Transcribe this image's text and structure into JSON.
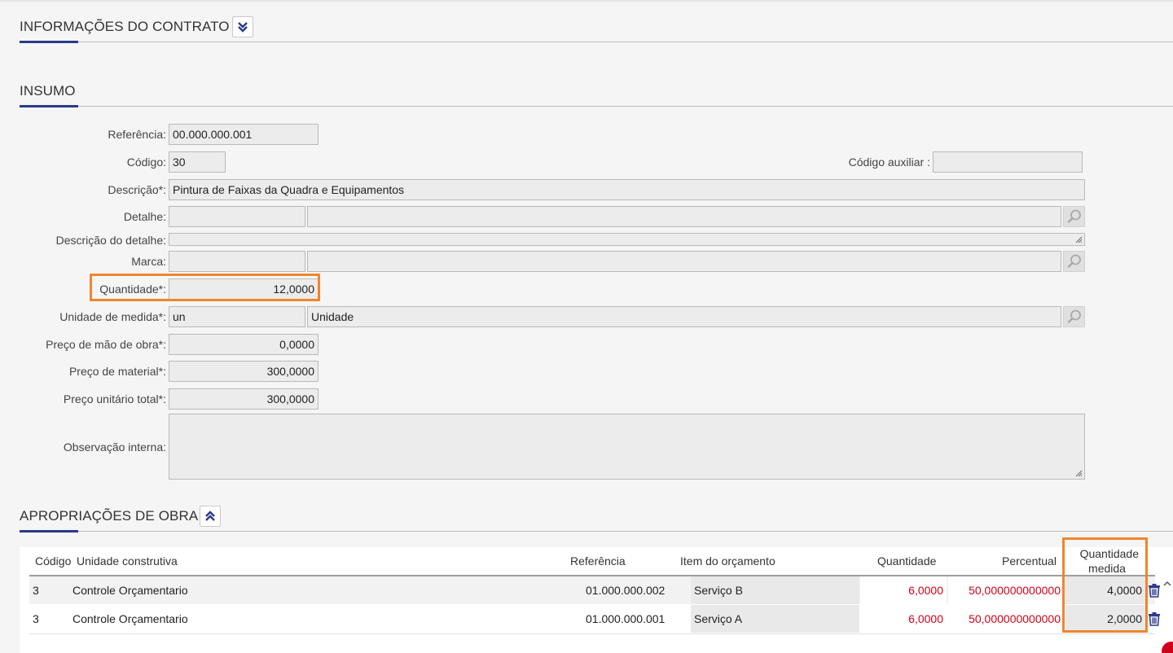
{
  "sections": {
    "contract_info": {
      "title": "INFORMAÇÕES DO CONTRATO"
    },
    "insumo": {
      "title": "INSUMO"
    },
    "apropriacoes": {
      "title": "APROPRIAÇÕES DE OBRA"
    }
  },
  "insumo_form": {
    "referencia": {
      "label": "Referência:",
      "value": "00.000.000.001"
    },
    "codigo": {
      "label": "Código:",
      "value": "30"
    },
    "codigo_auxiliar": {
      "label": "Código auxiliar :",
      "value": ""
    },
    "descricao": {
      "label": "Descrição*:",
      "value": "Pintura de Faixas da Quadra e Equipamentos"
    },
    "detalhe": {
      "label": "Detalhe:",
      "code": "",
      "name": ""
    },
    "descricao_detalhe": {
      "label": "Descrição do detalhe:",
      "value": ""
    },
    "marca": {
      "label": "Marca:",
      "code": "",
      "name": ""
    },
    "quantidade": {
      "label": "Quantidade*:",
      "value": "12,0000"
    },
    "unidade_medida": {
      "label": "Unidade de medida*:",
      "code": "un",
      "name": "Unidade"
    },
    "preco_mao_obra": {
      "label": "Preço de mão de obra*:",
      "value": "0,0000"
    },
    "preco_material": {
      "label": "Preço de material*:",
      "value": "300,0000"
    },
    "preco_unitario_total": {
      "label": "Preço unitário total*:",
      "value": "300,0000"
    },
    "observacao_interna": {
      "label": "Observação interna:",
      "value": ""
    }
  },
  "table": {
    "headers": {
      "codigo": "Código",
      "unidade": "Unidade construtiva",
      "referencia": "Referência",
      "item": "Item do orçamento",
      "quantidade": "Quantidade",
      "percentual": "Percentual",
      "qtd_medida_1": "Quantidade",
      "qtd_medida_2": "medida"
    },
    "rows": [
      {
        "codigo": "3",
        "unidade": "Controle Orçamentario",
        "referencia": "01.000.000.002",
        "item": "Serviço B",
        "quantidade": "6,0000",
        "percentual": "50,000000000000",
        "qtd_medida": "4,0000"
      },
      {
        "codigo": "3",
        "unidade": "Controle Orçamentario",
        "referencia": "01.000.000.001",
        "item": "Serviço A",
        "quantidade": "6,0000",
        "percentual": "50,000000000000",
        "qtd_medida": "2,0000"
      }
    ]
  },
  "icons": {
    "toggle_expand": "double-chevron-down-icon",
    "toggle_collapse": "double-chevron-up-icon",
    "search": "magnifier-icon",
    "delete": "trash-icon"
  },
  "colors": {
    "accent": "#2a3a8c",
    "highlight": "#f0852d",
    "negative": "#d0021b"
  }
}
